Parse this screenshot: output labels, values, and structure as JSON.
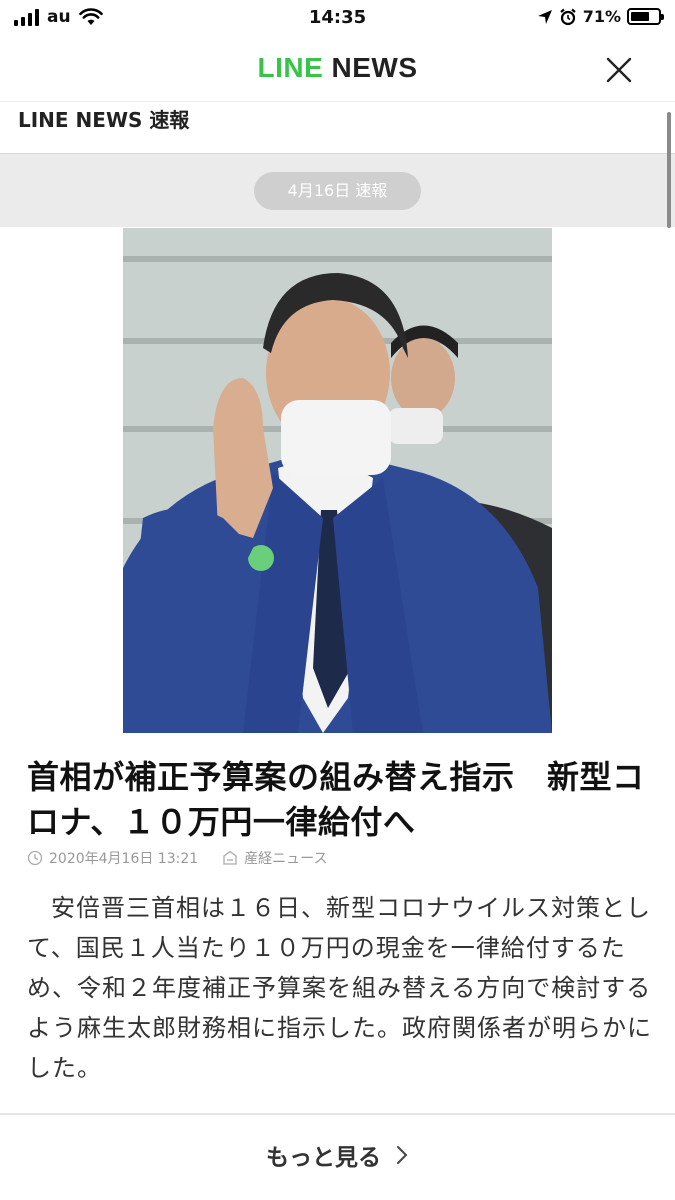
{
  "status_bar": {
    "carrier": "au",
    "time": "14:35",
    "battery": "71%",
    "battery_level": 0.71,
    "icons": [
      "signal-icon",
      "wifi-icon",
      "location-icon",
      "alarm-icon",
      "battery-icon"
    ]
  },
  "nav": {
    "logo_line": "LINE",
    "logo_news": "NEWS",
    "close_icon": "close-icon"
  },
  "section": {
    "title": "LINE NEWS 速報"
  },
  "date_pill": "4月16日 速報",
  "article": {
    "headline": "首相が補正予算案の組み替え指示　新型コロナ、１０万円一律給付へ",
    "datetime": "2020年4月16日 13:21",
    "source": "産経ニュース",
    "body": "安倍晋三首相は１６日、新型コロナウイルス対策として、国民１人当たり１０万円の現金を一律給付するため、令和２年度補正予算案を組み替える方向で検討するよう麻生太郎財務相に指示した。政府関係者が明らかにした。"
  },
  "more": {
    "label": "もっと見る"
  },
  "colors": {
    "brand_green": "#3ac34a",
    "pill_bg": "#cfcfcf",
    "band_bg": "#ebebeb"
  }
}
